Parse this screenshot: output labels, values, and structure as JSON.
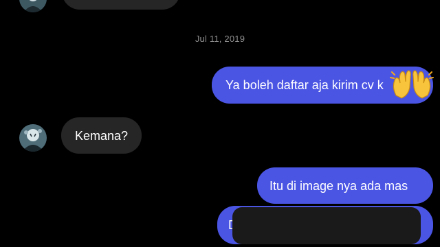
{
  "chat": {
    "date_separator": "Jul 11, 2019",
    "messages": [
      {
        "direction": "incoming",
        "text": ""
      },
      {
        "direction": "outgoing",
        "text": "Ya boleh daftar aja kirim cv k",
        "emoji": "raising-hands-emoji"
      },
      {
        "direction": "incoming",
        "text": "Kemana?"
      },
      {
        "direction": "outgoing",
        "text": "Itu di image nya ada mas"
      },
      {
        "direction": "outgoing",
        "text": "D",
        "redacted": true
      }
    ]
  },
  "colors": {
    "background": "#000000",
    "incoming_bubble": "#262626",
    "outgoing_bubble": "#4b55e4",
    "date_text": "#8e8e8e",
    "message_text": "#ffffff"
  }
}
